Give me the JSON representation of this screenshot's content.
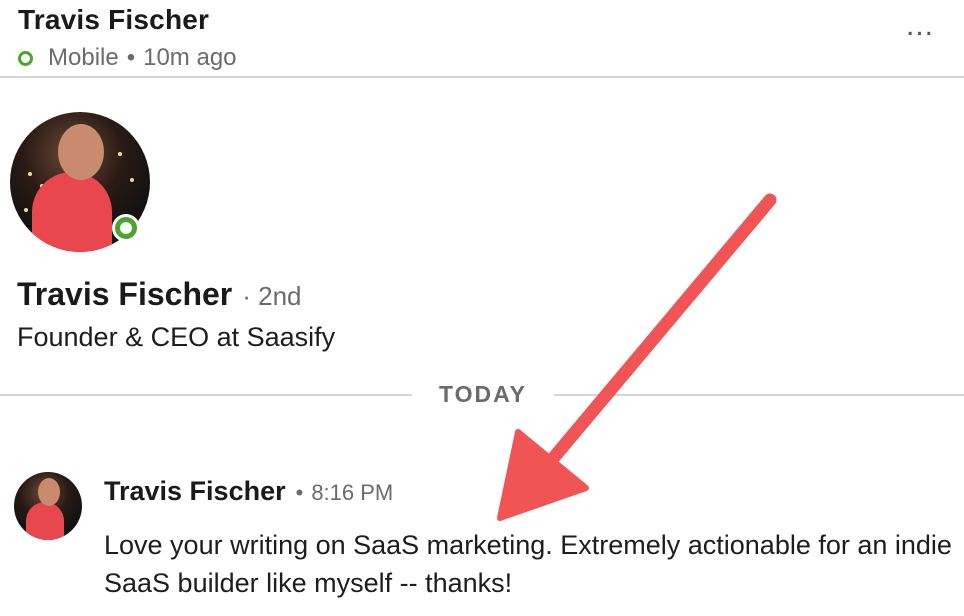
{
  "header": {
    "name": "Travis Fischer",
    "status_device": "Mobile",
    "status_separator": "•",
    "status_time": "10m ago",
    "more_label": "..."
  },
  "profile": {
    "name": "Travis Fischer",
    "degree": "· 2nd",
    "headline": "Founder & CEO at Saasify",
    "online": true
  },
  "divider": {
    "label": "TODAY"
  },
  "message": {
    "sender": "Travis Fischer",
    "separator": "•",
    "time": "8:16 PM",
    "body": "Love your writing on SaaS marketing. Extremely actionable for an indie SaaS builder like myself -- thanks!"
  },
  "icons": {
    "more": "more-horizontal-icon",
    "presence": "online-presence-icon",
    "annotation": "arrow-annotation-icon"
  },
  "colors": {
    "presence_green": "#4aa52e",
    "annotation_red": "#f05454",
    "muted_text": "#6b6b6b",
    "divider": "#d6d6d6"
  }
}
